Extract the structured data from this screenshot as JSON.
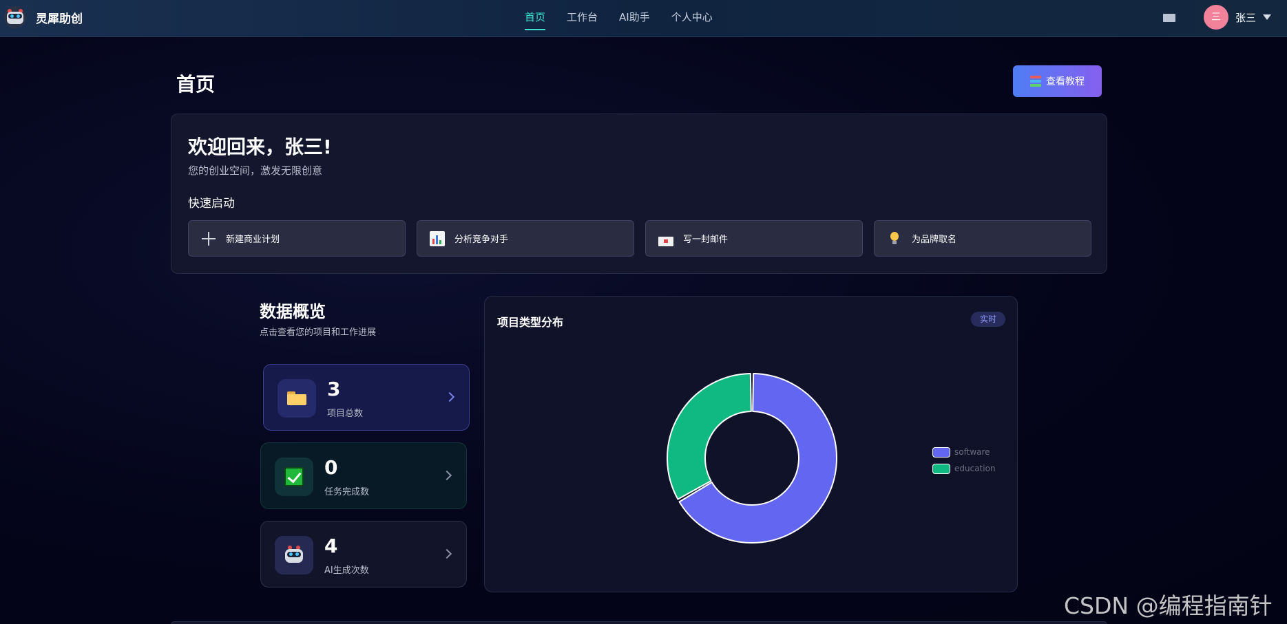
{
  "app": {
    "name": "灵犀助创"
  },
  "nav": {
    "items": [
      "首页",
      "工作台",
      "AI助手",
      "个人中心"
    ],
    "active": 0
  },
  "user": {
    "avatar_text": "三",
    "name": "张三"
  },
  "page": {
    "title": "首页",
    "tutorial_label": "查看教程"
  },
  "welcome": {
    "title": "欢迎回来，张三!",
    "subtitle": "您的创业空间，激发无限创意",
    "quick_title": "快速启动",
    "quick_actions": [
      {
        "label": "新建商业计划",
        "icon": "plus-icon"
      },
      {
        "label": "分析竞争对手",
        "icon": "bar-chart-icon"
      },
      {
        "label": "写一封邮件",
        "icon": "mail-icon"
      },
      {
        "label": "为品牌取名",
        "icon": "lightbulb-icon"
      }
    ]
  },
  "overview": {
    "title": "数据概览",
    "subtitle": "点击查看您的项目和工作进展",
    "stats": [
      {
        "value": "3",
        "label": "项目总数",
        "icon": "folder-icon"
      },
      {
        "value": "0",
        "label": "任务完成数",
        "icon": "check-icon"
      },
      {
        "value": "4",
        "label": "AI生成次数",
        "icon": "robot-icon"
      }
    ]
  },
  "chart_card": {
    "title": "项目类型分布",
    "badge": "实时"
  },
  "chart_data": {
    "type": "pie",
    "title": "项目类型分布",
    "categories": [
      "software",
      "education"
    ],
    "values": [
      2,
      1
    ],
    "colors": [
      "#6366f1",
      "#10b981"
    ],
    "legend": "right"
  },
  "watermark": "CSDN @编程指南针"
}
